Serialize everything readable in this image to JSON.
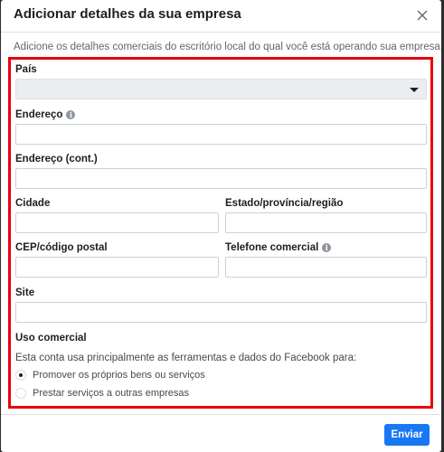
{
  "dialog": {
    "title": "Adicionar detalhes da sua empresa",
    "subtitle": "Adicione os detalhes comerciais do escritório local do qual você está operando sua empresa."
  },
  "form": {
    "country_label": "País",
    "country_value": "",
    "address_label": "Endereço",
    "address2_label": "Endereço (cont.)",
    "city_label": "Cidade",
    "state_label": "Estado/província/região",
    "zip_label": "CEP/código postal",
    "phone_label": "Telefone comercial",
    "site_label": "Site",
    "usage_label": "Uso comercial",
    "usage_text": "Esta conta usa principalmente as ferramentas e dados do Facebook para:",
    "usage_options": [
      {
        "label": "Promover os próprios bens ou serviços",
        "selected": true
      },
      {
        "label": "Prestar serviços a outras empresas",
        "selected": false
      }
    ]
  },
  "footer": {
    "submit_label": "Enviar"
  },
  "icons": {
    "info": "info-icon",
    "close": "close-icon",
    "dropdown": "chevron-down-icon"
  },
  "colors": {
    "accent": "#1877f2",
    "highlight": "#e8000d"
  }
}
